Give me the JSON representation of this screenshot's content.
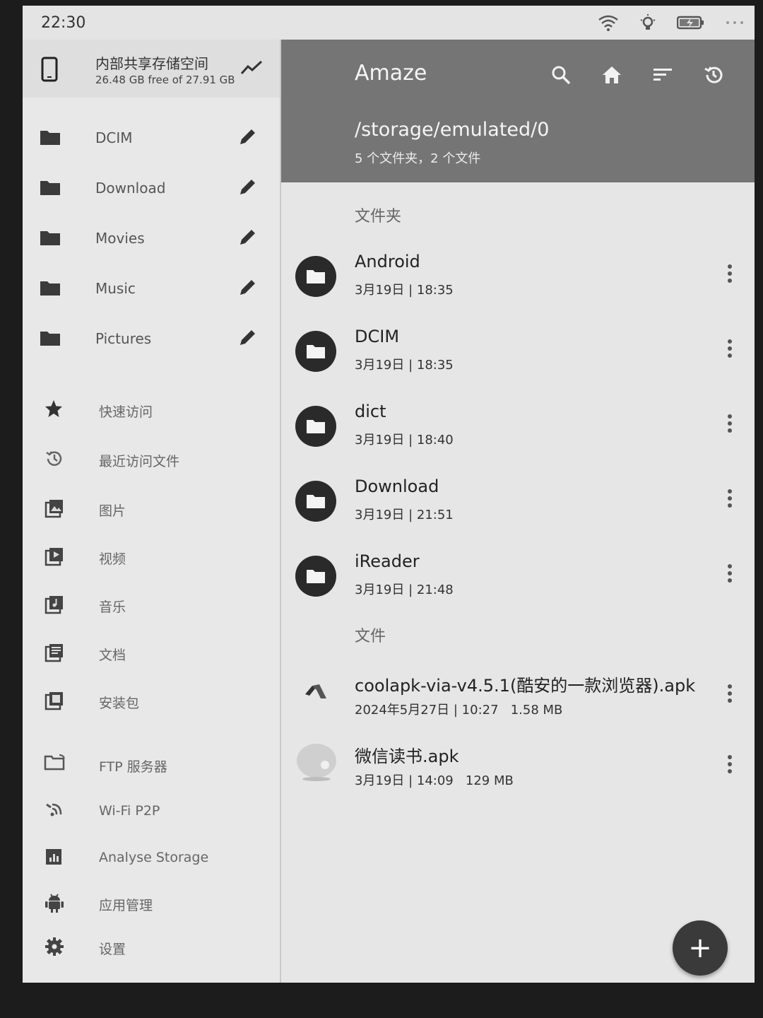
{
  "status_bar": {
    "time": "22:30"
  },
  "storage": {
    "name": "内部共享存储空间",
    "free": "26.48 GB free of 27.91 GB"
  },
  "sidebar": {
    "folders": [
      {
        "label": "DCIM"
      },
      {
        "label": "Download"
      },
      {
        "label": "Movies"
      },
      {
        "label": "Music"
      },
      {
        "label": "Pictures"
      }
    ],
    "items": [
      {
        "label": "快速访问",
        "icon": "star-icon"
      },
      {
        "label": "最近访问文件",
        "icon": "history-icon"
      },
      {
        "label": "图片",
        "icon": "image-icon"
      },
      {
        "label": "视频",
        "icon": "video-icon"
      },
      {
        "label": "音乐",
        "icon": "music-icon"
      },
      {
        "label": "文档",
        "icon": "document-icon"
      },
      {
        "label": "安装包",
        "icon": "package-icon"
      },
      {
        "label": "FTP 服务器",
        "icon": "ftp-icon"
      },
      {
        "label": "Wi-Fi P2P",
        "icon": "wifi-p2p-icon"
      },
      {
        "label": "Analyse Storage",
        "icon": "analyse-icon"
      },
      {
        "label": "应用管理",
        "icon": "android-icon"
      },
      {
        "label": "设置",
        "icon": "gear-icon"
      }
    ]
  },
  "appbar": {
    "title": "Amaze",
    "path": "/storage/emulated/0",
    "count": "5 个文件夹，2 个文件"
  },
  "main": {
    "folders_header": "文件夹",
    "files_header": "文件",
    "folders": [
      {
        "name": "Android",
        "meta": "3月19日 | 18:35"
      },
      {
        "name": "DCIM",
        "meta": "3月19日 | 18:35"
      },
      {
        "name": "dict",
        "meta": "3月19日 | 18:40"
      },
      {
        "name": "Download",
        "meta": "3月19日 | 21:51"
      },
      {
        "name": "iReader",
        "meta": "3月19日 | 21:48"
      }
    ],
    "files": [
      {
        "name": "coolapk-via-v4.5.1(酷安的一款浏览器).apk",
        "meta": "2024年5月27日 | 10:27   1.58 MB"
      },
      {
        "name": "微信读书.apk",
        "meta": "3月19日 | 14:09   129 MB"
      }
    ]
  },
  "fab": {
    "label": "+"
  }
}
